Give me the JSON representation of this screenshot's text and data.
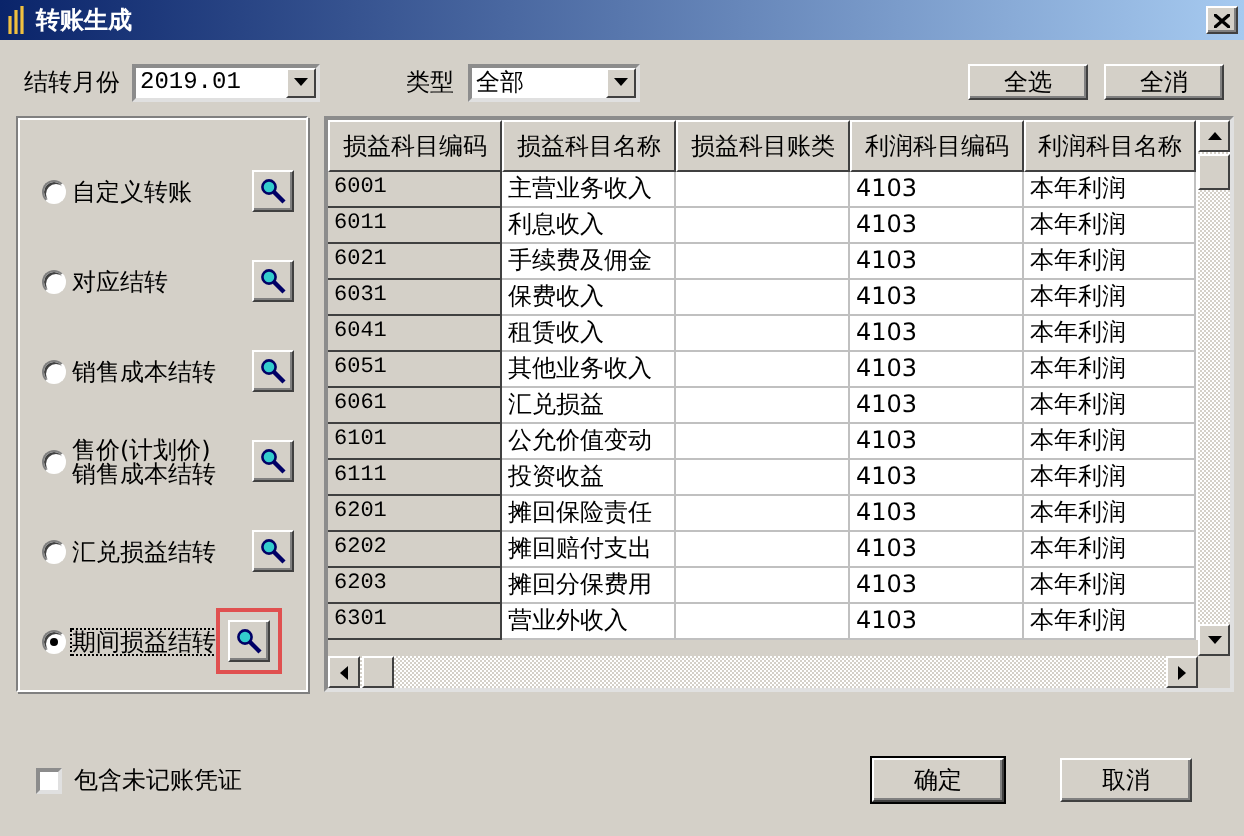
{
  "window": {
    "title": "转账生成"
  },
  "filters": {
    "month_label": "结转月份",
    "month_value": "2019.01",
    "type_label": "类型",
    "type_value": "全部"
  },
  "top_buttons": [
    "全选",
    "全消"
  ],
  "options": [
    {
      "label": "自定义转账",
      "selected": false,
      "highlighted": false
    },
    {
      "label": "对应结转",
      "selected": false,
      "highlighted": false
    },
    {
      "label": "销售成本结转",
      "selected": false,
      "highlighted": false
    },
    {
      "label": "售价(计划价)\n销售成本结转",
      "selected": false,
      "highlighted": false
    },
    {
      "label": "汇兑损益结转",
      "selected": false,
      "highlighted": false
    },
    {
      "label": "期间损益结转",
      "selected": true,
      "highlighted": true
    }
  ],
  "table": {
    "columns": [
      "损益科目编码",
      "损益科目名称",
      "损益科目账类",
      "利润科目编码",
      "利润科目名称"
    ],
    "rows": [
      [
        "6001",
        "主营业务收入",
        "",
        "4103",
        "本年利润"
      ],
      [
        "6011",
        "利息收入",
        "",
        "4103",
        "本年利润"
      ],
      [
        "6021",
        "手续费及佣金",
        "",
        "4103",
        "本年利润"
      ],
      [
        "6031",
        "保费收入",
        "",
        "4103",
        "本年利润"
      ],
      [
        "6041",
        "租赁收入",
        "",
        "4103",
        "本年利润"
      ],
      [
        "6051",
        "其他业务收入",
        "",
        "4103",
        "本年利润"
      ],
      [
        "6061",
        "汇兑损益",
        "",
        "4103",
        "本年利润"
      ],
      [
        "6101",
        "公允价值变动",
        "",
        "4103",
        "本年利润"
      ],
      [
        "6111",
        "投资收益",
        "",
        "4103",
        "本年利润"
      ],
      [
        "6201",
        "摊回保险责任",
        "",
        "4103",
        "本年利润"
      ],
      [
        "6202",
        "摊回赔付支出",
        "",
        "4103",
        "本年利润"
      ],
      [
        "6203",
        "摊回分保费用",
        "",
        "4103",
        "本年利润"
      ],
      [
        "6301",
        "营业外收入",
        "",
        "4103",
        "本年利润"
      ]
    ]
  },
  "footer": {
    "include_unposted": {
      "label": "包含未记账凭证",
      "checked": false
    },
    "buttons": [
      "确定",
      "取消"
    ]
  }
}
